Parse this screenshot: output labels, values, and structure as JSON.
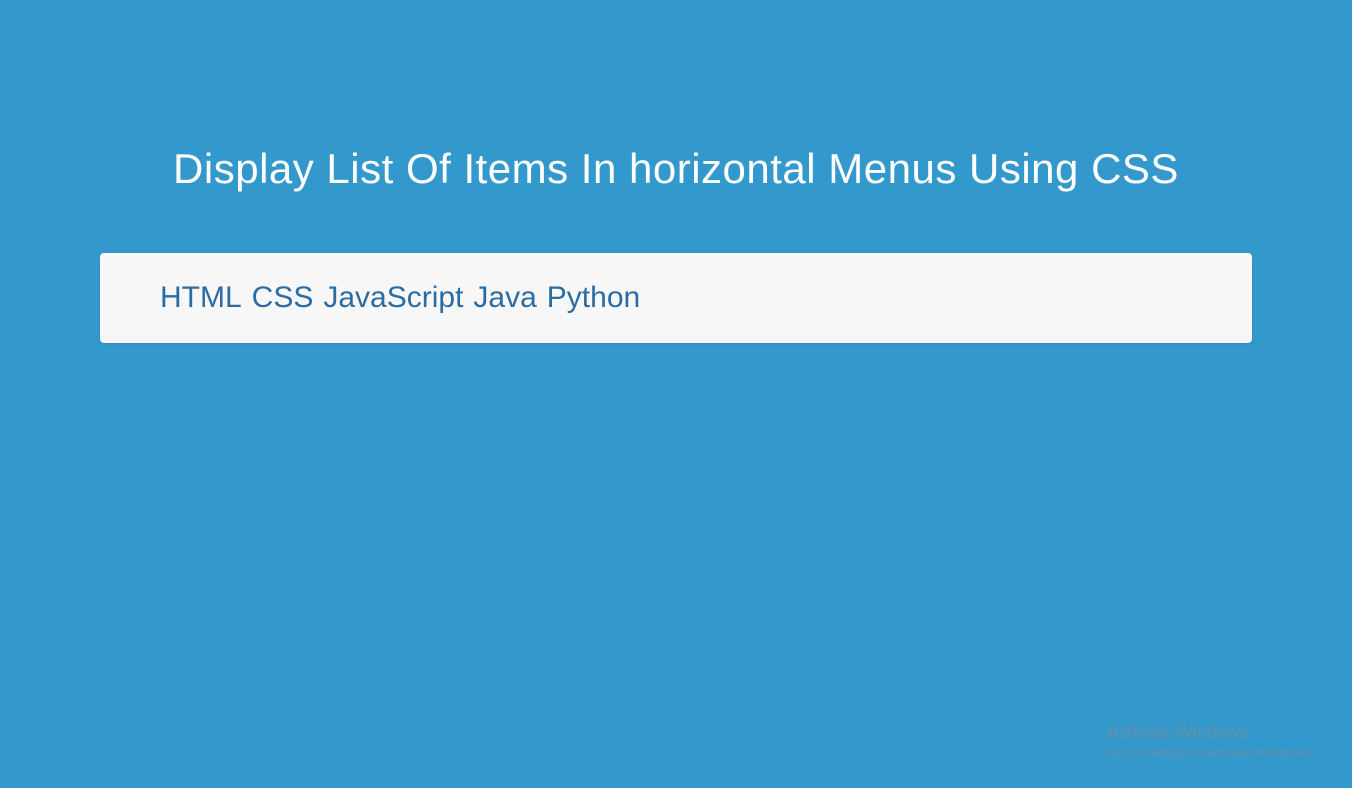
{
  "title": "Display List Of Items In horizontal Menus Using CSS",
  "menu": {
    "items": [
      {
        "label": "HTML"
      },
      {
        "label": "CSS"
      },
      {
        "label": "JavaScript"
      },
      {
        "label": "Java"
      },
      {
        "label": "Python"
      }
    ]
  },
  "watermark": {
    "title": "Activate Windows",
    "subtitle": "Go to Settings to activate Windows."
  }
}
